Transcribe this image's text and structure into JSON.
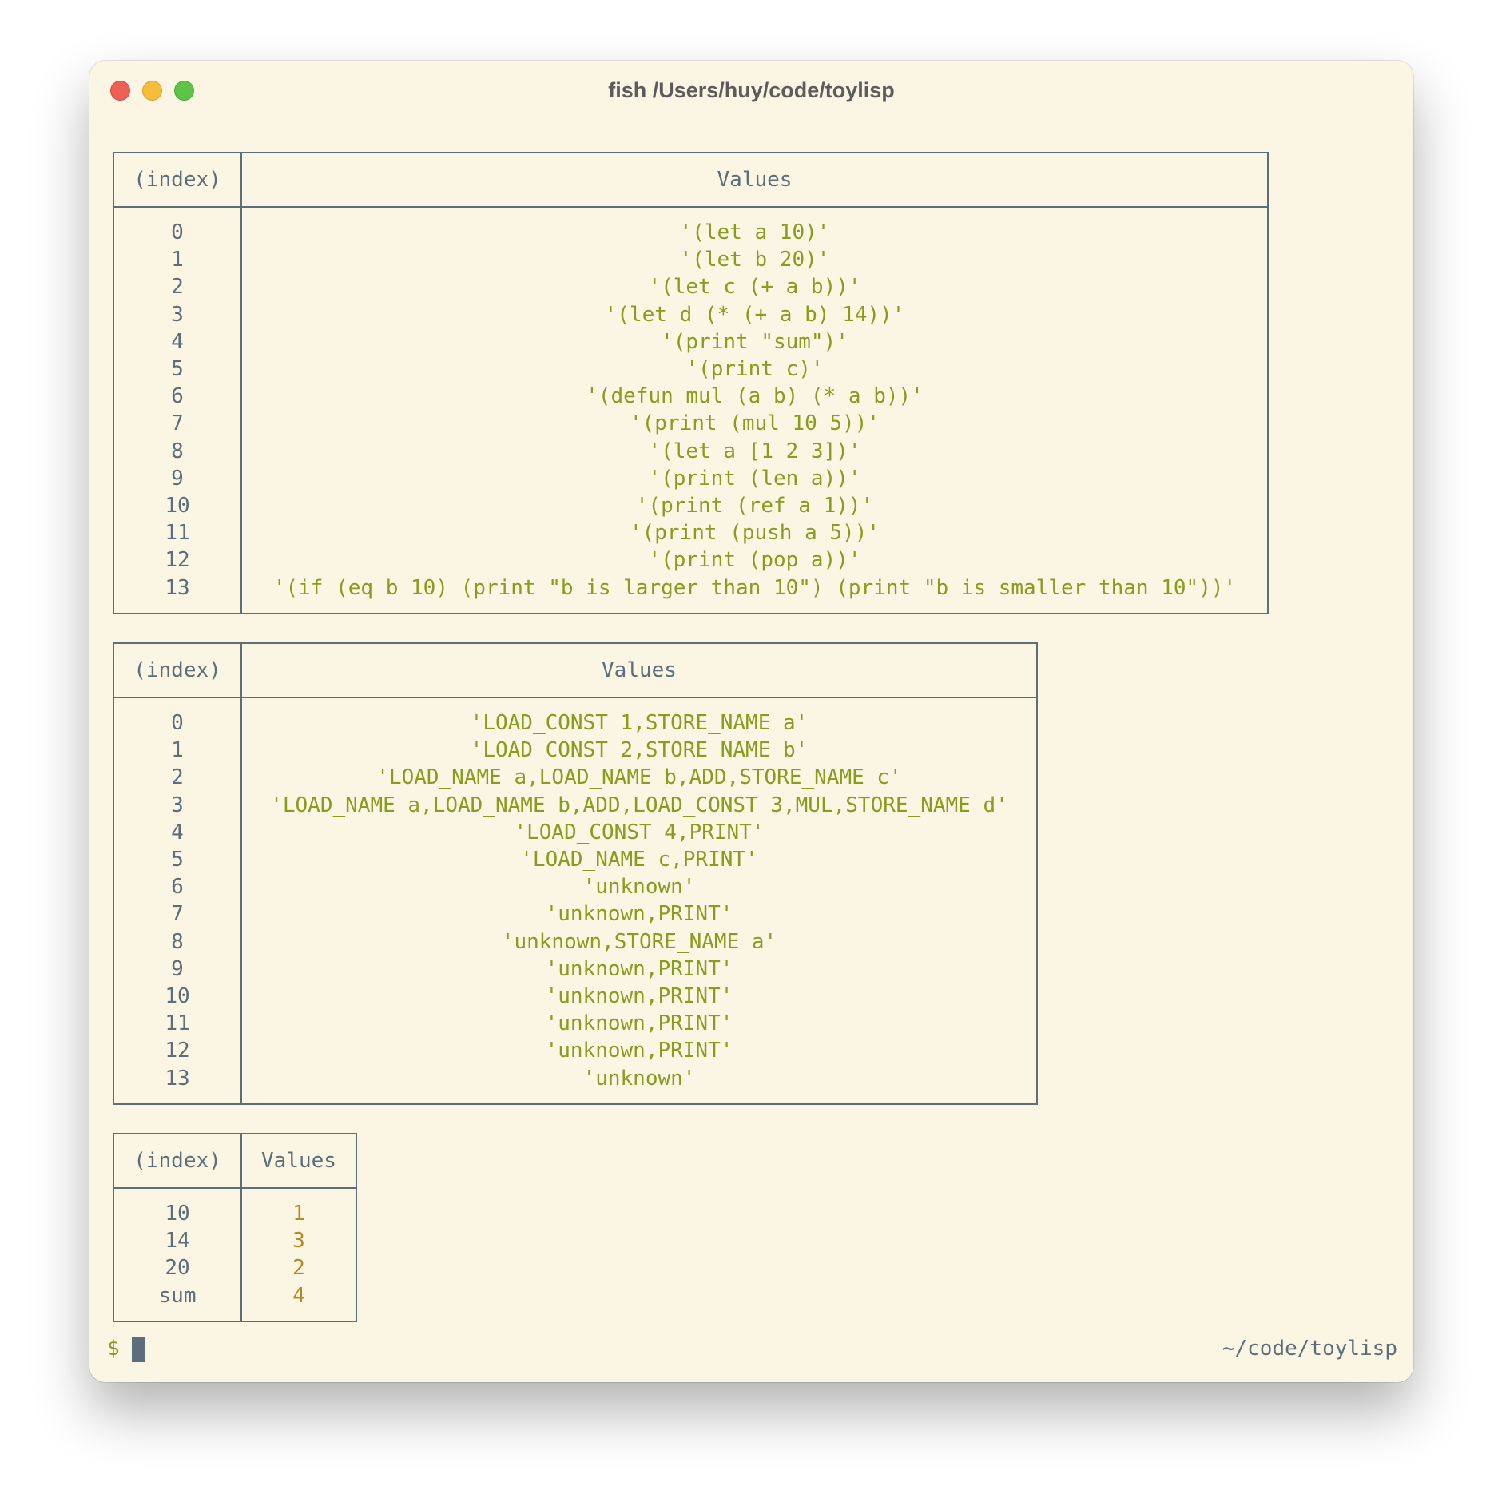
{
  "window": {
    "title": "fish /Users/huy/code/toylisp"
  },
  "tables": [
    {
      "headers": [
        "(index)",
        "Values"
      ],
      "rows": [
        [
          "0",
          "'(let a 10)'"
        ],
        [
          "1",
          "'(let b 20)'"
        ],
        [
          "2",
          "'(let c (+ a b))'"
        ],
        [
          "3",
          "'(let d (* (+ a b) 14))'"
        ],
        [
          "4",
          "'(print \"sum\")'"
        ],
        [
          "5",
          "'(print c)'"
        ],
        [
          "6",
          "'(defun mul (a b) (* a b))'"
        ],
        [
          "7",
          "'(print (mul 10 5))'"
        ],
        [
          "8",
          "'(let a [1 2 3])'"
        ],
        [
          "9",
          "'(print (len a))'"
        ],
        [
          "10",
          "'(print (ref a 1))'"
        ],
        [
          "11",
          "'(print (push a 5))'"
        ],
        [
          "12",
          "'(print (pop a))'"
        ],
        [
          "13",
          "'(if (eq b 10) (print \"b is larger than 10\") (print \"b is smaller than 10\"))'"
        ]
      ]
    },
    {
      "headers": [
        "(index)",
        "Values"
      ],
      "rows": [
        [
          "0",
          "'LOAD_CONST 1,STORE_NAME a'"
        ],
        [
          "1",
          "'LOAD_CONST 2,STORE_NAME b'"
        ],
        [
          "2",
          "'LOAD_NAME a,LOAD_NAME b,ADD,STORE_NAME c'"
        ],
        [
          "3",
          "'LOAD_NAME a,LOAD_NAME b,ADD,LOAD_CONST 3,MUL,STORE_NAME d'"
        ],
        [
          "4",
          "'LOAD_CONST 4,PRINT'"
        ],
        [
          "5",
          "'LOAD_NAME c,PRINT'"
        ],
        [
          "6",
          "'unknown'"
        ],
        [
          "7",
          "'unknown,PRINT'"
        ],
        [
          "8",
          "'unknown,STORE_NAME a'"
        ],
        [
          "9",
          "'unknown,PRINT'"
        ],
        [
          "10",
          "'unknown,PRINT'"
        ],
        [
          "11",
          "'unknown,PRINT'"
        ],
        [
          "12",
          "'unknown,PRINT'"
        ],
        [
          "13",
          "'unknown'"
        ]
      ]
    },
    {
      "headers": [
        "(index)",
        "Values"
      ],
      "rows": [
        [
          "10",
          "1"
        ],
        [
          "14",
          "3"
        ],
        [
          "20",
          "2"
        ],
        [
          "sum",
          "4"
        ]
      ]
    }
  ],
  "prompt": {
    "symbol": "$",
    "cwd": "~/code/toylisp"
  },
  "colors": {
    "background": "#fbf5e4",
    "string": "#8a9c1e",
    "number": "#b58a1c",
    "index": "#5b6e7a",
    "close": "#ee5f57",
    "minimize": "#f5bd3a",
    "maximize": "#5ec447"
  }
}
